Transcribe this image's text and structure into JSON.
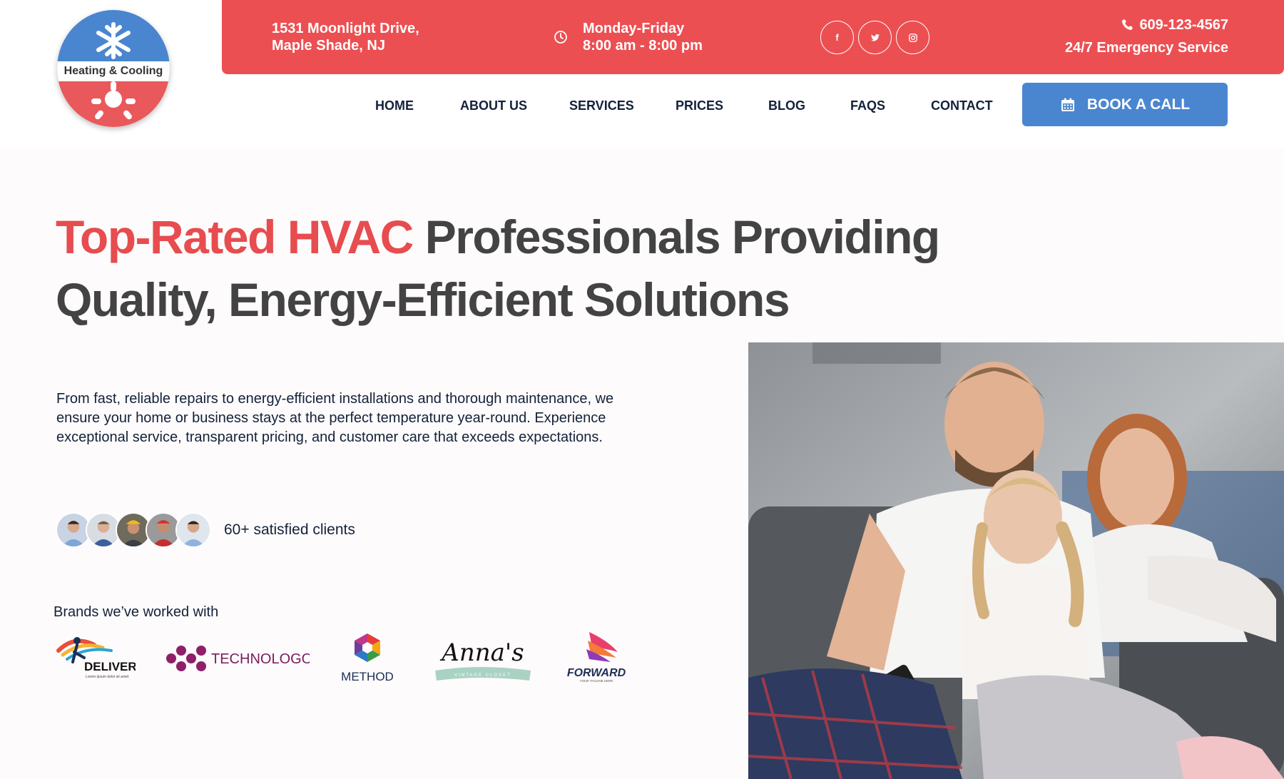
{
  "brand": {
    "logo_text": "Heating & Cooling"
  },
  "topbar": {
    "address_line1": "1531 Moonlight Drive,",
    "address_line2": "Maple Shade, NJ",
    "hours_line1": "Monday-Friday",
    "hours_line2": "8:00 am - 8:00 pm",
    "social": [
      {
        "icon": "facebook-icon",
        "glyph": "f"
      },
      {
        "icon": "twitter-icon",
        "glyph": "t"
      },
      {
        "icon": "instagram-icon",
        "glyph": "◎"
      }
    ],
    "phone": "609-123-4567",
    "emergency": "24/7 Emergency Service"
  },
  "nav": {
    "items": [
      "HOME",
      "ABOUT US",
      "SERVICES",
      "PRICES",
      "BLOG",
      "FAQS",
      "CONTACT"
    ],
    "book_label": "BOOK A CALL"
  },
  "hero": {
    "title_accent": "Top-Rated HVAC",
    "title_rest": " Professionals Providing Quality, Energy-Efficient Solutions",
    "description": "From fast, reliable repairs to energy-efficient installations and thorough maintenance, we ensure your home or business stays at the perfect temperature year-round. Experience exceptional service, transparent pricing, and customer care that exceeds expectations.",
    "clients_text": "60+ satisfied clients"
  },
  "brands": {
    "title": "Brands we’ve worked with",
    "items": [
      {
        "name": "DELIVERY",
        "tagline": "Lorem ipsum dolor sit amet"
      },
      {
        "name": "TECHNOLOGO"
      },
      {
        "name": "METHOD"
      },
      {
        "name": "Anna's",
        "tagline": "VINTAGE CLOSET"
      },
      {
        "name": "FORWARD",
        "tagline": "YOUR TAGLINE HERE"
      }
    ]
  },
  "colors": {
    "accent_red": "#ec4f52",
    "button_blue": "#4a86cf",
    "heading_gray": "#434343",
    "nav_text": "#13213a"
  }
}
